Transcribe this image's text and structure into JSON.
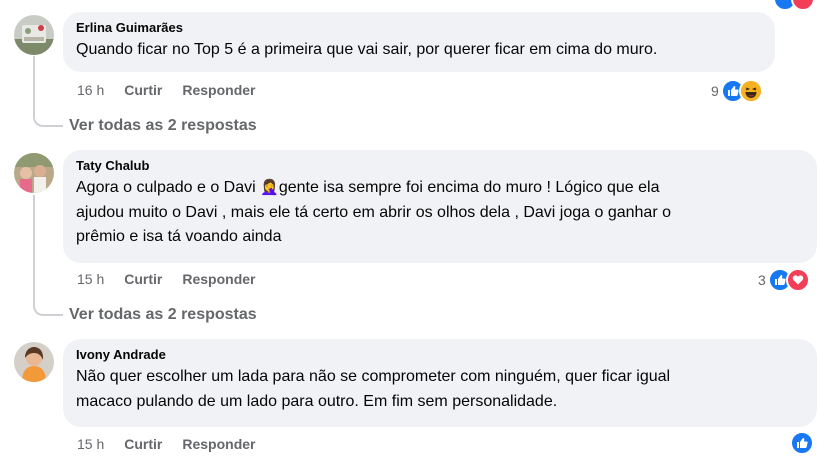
{
  "comments": [
    {
      "author": "Erlina Guimarães",
      "lines": [
        "Quando ficar no Top 5 é a primeira que vai sair, por querer ficar em cima do muro."
      ],
      "time": "16 h",
      "like_label": "Curtir",
      "reply_label": "Responder",
      "reaction_count": "9",
      "reactions": [
        "like-icon",
        "haha-icon"
      ],
      "view_replies": "Ver todas as 2 respostas"
    },
    {
      "author": "Taty Chalub",
      "lines": [
        "Agora o culpado e o Davi ",
        "gente isa sempre foi encima do muro ! Lógico que ela",
        "ajudou muito o Davi , mais ele tá certo em abrir os olhos dela , Davi joga o ganhar o",
        "prêmio e isa tá voando ainda"
      ],
      "emoji": "🤦‍♀️",
      "time": "15 h",
      "like_label": "Curtir",
      "reply_label": "Responder",
      "reaction_count": "3",
      "reactions": [
        "like-icon",
        "love-icon"
      ],
      "view_replies": "Ver todas as 2 respostas"
    },
    {
      "author": "Ivony Andrade",
      "lines": [
        "Não quer escolher um lada para não se comprometer com ninguém, quer ficar igual",
        "macaco pulando de um lado para outro. Em fim sem personalidade."
      ],
      "time": "15 h",
      "like_label": "Curtir",
      "reply_label": "Responder",
      "reactions": [
        "like-icon"
      ]
    }
  ],
  "colors": {
    "bubble_bg": "#f0f2f5",
    "meta_text": "#65676b",
    "like_blue": "#1877f2",
    "love_red": "#f33e58",
    "haha_yellow": "#f7b125",
    "thread_line": "#ced0d4"
  }
}
